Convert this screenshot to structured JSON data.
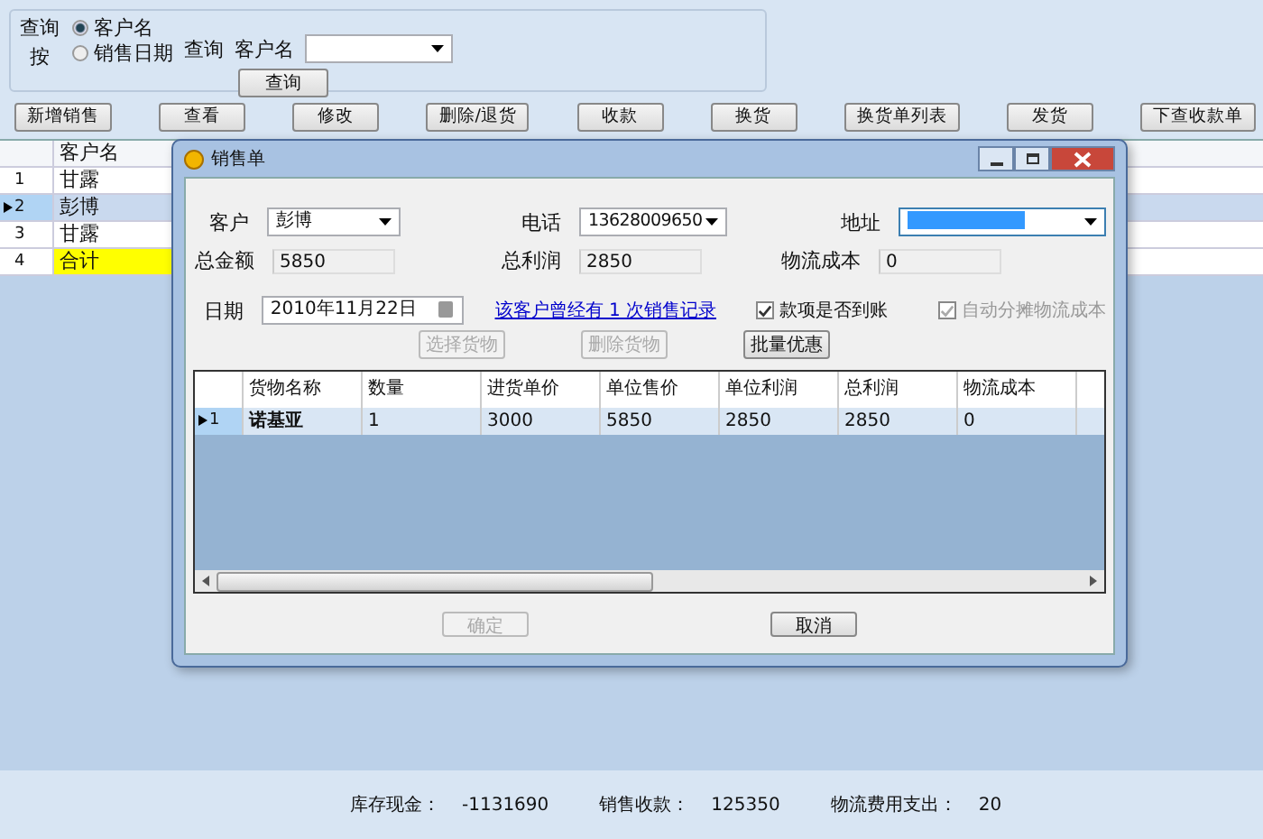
{
  "query": {
    "group_label": "查询按",
    "radios": [
      {
        "label": "客户名",
        "selected": true
      },
      {
        "label": "销售日期",
        "selected": false
      }
    ],
    "query_label": "查询",
    "field_label": "客户名",
    "button": "查询"
  },
  "toolbar": [
    "新增销售",
    "查看",
    "修改",
    "删除/退货",
    "收款",
    "换货",
    "换货单列表",
    "发货",
    "下查收款单"
  ],
  "grid": {
    "columns": [
      "客户名"
    ],
    "rows": [
      {
        "number": "1",
        "name": "甘露",
        "selected": false,
        "highlight": false
      },
      {
        "number": "2",
        "name": "彭博",
        "selected": true,
        "highlight": false
      },
      {
        "number": "3",
        "name": "甘露",
        "selected": false,
        "highlight": false
      },
      {
        "number": "4",
        "name": "合计",
        "selected": false,
        "highlight": true
      }
    ]
  },
  "dialog": {
    "title": "销售单",
    "customer": {
      "label": "客户",
      "value": "彭博"
    },
    "phone": {
      "label": "电话",
      "value": "13628009650"
    },
    "address": {
      "label": "地址",
      "selected": true
    },
    "total_amount": {
      "label": "总金额",
      "value": "5850"
    },
    "total_profit": {
      "label": "总利润",
      "value": "2850"
    },
    "logistics_cost": {
      "label": "物流成本",
      "value": "0"
    },
    "date": {
      "label": "日期",
      "value": "2010年11月22日"
    },
    "history_link": "该客户曾经有 1 次销售记录",
    "checkboxes": [
      {
        "label": "款项是否到账",
        "checked": true,
        "disabled": false
      },
      {
        "label": "自动分摊物流成本",
        "checked": true,
        "disabled": true
      }
    ],
    "actions": [
      {
        "label": "选择货物",
        "disabled": true
      },
      {
        "label": "删除货物",
        "disabled": true
      },
      {
        "label": "批量优惠",
        "disabled": false
      }
    ],
    "table": {
      "columns": [
        "货物名称",
        "数量",
        "进货单价",
        "单位售价",
        "单位利润",
        "总利润",
        "物流成本"
      ],
      "rows": [
        {
          "number": "1",
          "selected": true,
          "cells": [
            "诺基亚",
            "1",
            "3000",
            "5850",
            "2850",
            "2850",
            "0"
          ]
        }
      ]
    },
    "buttons": [
      {
        "label": "确定",
        "disabled": true
      },
      {
        "label": "取消",
        "disabled": false
      }
    ]
  },
  "status_bar": [
    {
      "label": "库存现金：",
      "value": "-1131690"
    },
    {
      "label": "销售收款：",
      "value": "125350"
    },
    {
      "label": "物流费用支出：",
      "value": "20"
    }
  ]
}
